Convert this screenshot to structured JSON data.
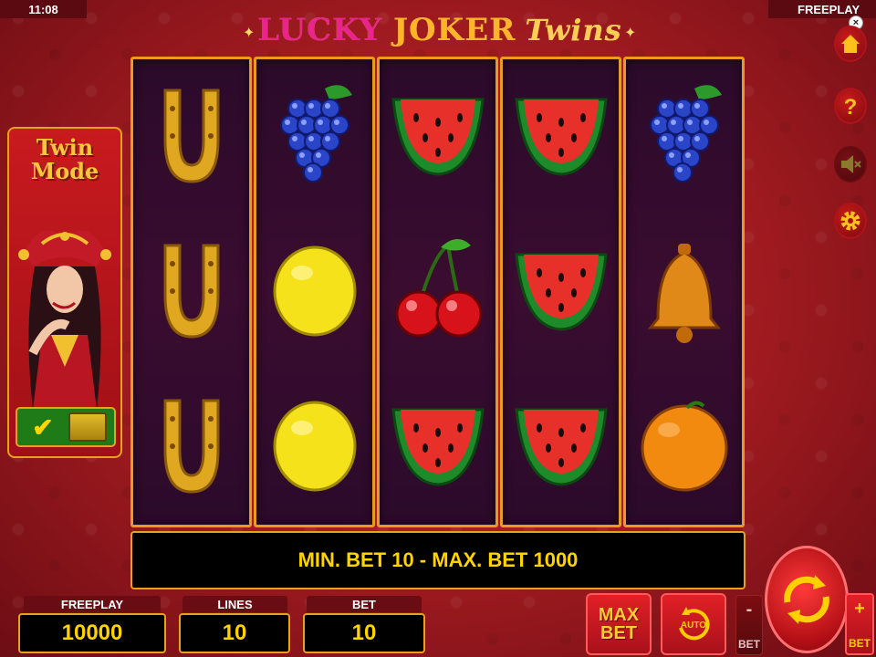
{
  "status_bar": {
    "time": "11:08",
    "mode": "FREEPLAY"
  },
  "title": {
    "word1": "LUCKY",
    "word2": "JOKER",
    "word3": "Twins"
  },
  "twin_mode": {
    "title_line1": "Twin",
    "title_line2": "Mode",
    "enabled": true
  },
  "reels": [
    [
      "horseshoe",
      "horseshoe",
      "horseshoe"
    ],
    [
      "grapes",
      "lemon",
      "lemon"
    ],
    [
      "watermelon",
      "cherries",
      "watermelon"
    ],
    [
      "watermelon",
      "watermelon",
      "watermelon"
    ],
    [
      "grapes",
      "bell",
      "orange"
    ]
  ],
  "message": "MIN. BET 10 - MAX. BET 1000",
  "stats": {
    "freeplay_label": "FREEPLAY",
    "freeplay_value": "10000",
    "lines_label": "LINES",
    "lines_value": "10",
    "bet_label": "BET",
    "bet_value": "10"
  },
  "buttons": {
    "max_bet_line1": "MAX",
    "max_bet_line2": "BET",
    "auto": "AUTO",
    "bet_minus_sign": "-",
    "bet_minus_label": "BET",
    "bet_plus_sign": "+",
    "bet_plus_label": "BET"
  },
  "side_menu": [
    "home-icon",
    "help-icon",
    "sound-off-icon",
    "settings-icon"
  ],
  "colors": {
    "frame": "#e89b22",
    "background": "#9d1a1f",
    "message_text": "#ffd200"
  }
}
